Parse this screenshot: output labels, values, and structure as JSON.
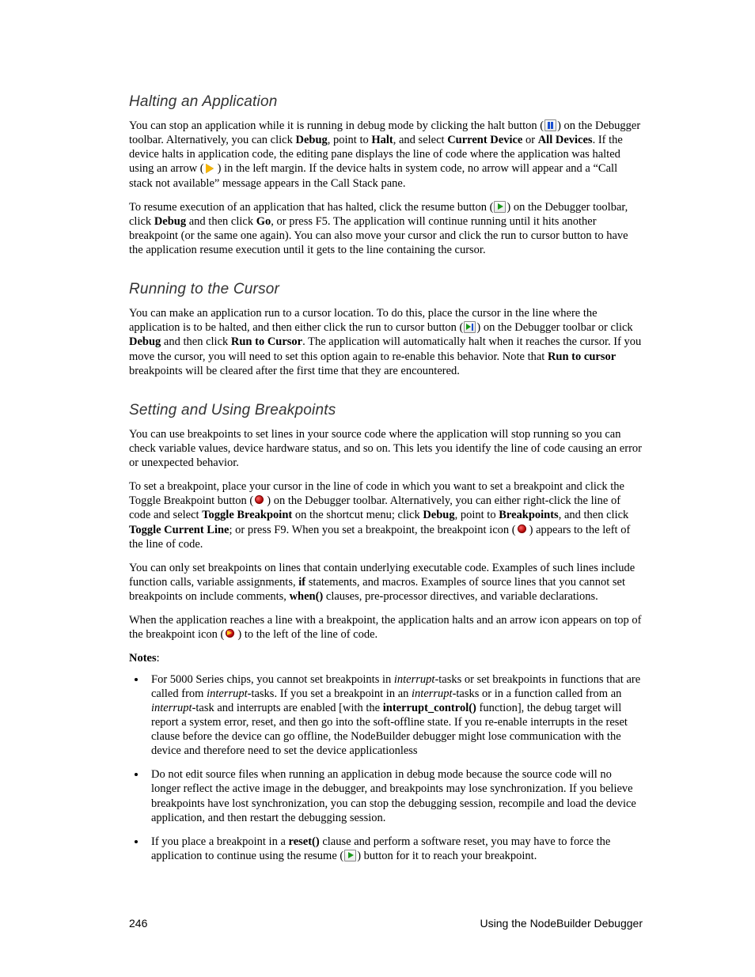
{
  "footer": {
    "page_number": "246",
    "title": "Using the NodeBuilder Debugger"
  },
  "sections": {
    "halting": {
      "heading": "Halting an Application",
      "p1": {
        "a": "You can stop an application while it is running in debug mode by clicking the halt button (",
        "b": ") on the Debugger toolbar.  Alternatively, you can click ",
        "bold_debug": "Debug",
        "c": ", point to ",
        "bold_halt": "Halt",
        "d": ", and select ",
        "bold_current": "Current Device",
        "e": " or ",
        "bold_all": "All Devices",
        "f": ".  If the device halts in application code, the editing pane displays the line of code where the application was halted using an arrow (",
        "g": ") in the left margin.  If the device halts in system code, no arrow will appear and a “Call stack not available” message appears in the Call Stack pane."
      },
      "p2": {
        "a": "To resume execution of an application that has halted, click the resume button (",
        "b": ") on the Debugger toolbar, click ",
        "bold_debug": "Debug",
        "c": " and then click ",
        "bold_go": "Go",
        "d": ", or press F5.  The application will continue running until it hits another breakpoint (or the same one again).  You can also move your cursor and click the run to cursor button to have the application resume execution until it gets to the line containing the cursor."
      }
    },
    "running": {
      "heading": "Running to the Cursor",
      "p1": {
        "a": "You can make an application run to a cursor location.  To do this, place the cursor in the line where the application is to be halted, and then either click the run to cursor button (",
        "b": ") on the Debugger toolbar or click ",
        "bold_debug": "Debug",
        "c": " and then click ",
        "bold_rtc": "Run to Cursor",
        "d": ".  The application will automatically halt when it reaches the cursor.  If you move the cursor, you will need to set this option again to re-enable this behavior.  Note that ",
        "bold_rtc2": "Run to cursor",
        "e": " breakpoints will be cleared after the first time that they are encountered."
      }
    },
    "breakpoints": {
      "heading": "Setting and Using Breakpoints",
      "p1": "You can use breakpoints to set lines in your source code where the application will stop running so you can check variable values, device hardware status, and so on.  This lets you identify the line of code causing an error or unexpected behavior.",
      "p2": {
        "a": "To set a breakpoint, place your cursor in the line of code in which you want to set a breakpoint and click the Toggle Breakpoint button (",
        "b": ") on the Debugger toolbar.  Alternatively, you can either right-click the line of code and select ",
        "bold_tb": "Toggle Breakpoint",
        "c": " on the shortcut menu; click ",
        "bold_debug": "Debug",
        "d": ", point to ",
        "bold_bp": "Breakpoints",
        "e": ", and then click ",
        "bold_tcl": "Toggle Current Line",
        "f": "; or press F9.  When you set a breakpoint, the breakpoint icon (",
        "g": ") appears to the left of the line of code."
      },
      "p3": {
        "a": "You can only set breakpoints on lines that contain underlying executable code.  Examples of such lines include function calls, variable assignments, ",
        "bold_if": "if",
        "b": " statements, and macros.  Examples of source lines that you cannot set breakpoints on include comments, ",
        "bold_when": "when()",
        "c": " clauses, pre-processor directives, and variable declarations."
      },
      "p4": {
        "a": "When the application reaches a line with a breakpoint, the application halts and an arrow icon appears on top of the breakpoint icon (",
        "b": ") to the left of the line of code."
      },
      "notes_label": "Notes",
      "notes": [
        {
          "a": "For 5000 Series chips, you cannot set breakpoints in ",
          "it_int": "interrupt",
          "b": "-tasks or set breakpoints in functions that are called from ",
          "it_int2": "interrupt",
          "c": "-tasks.  If you set a breakpoint in an ",
          "it_int3": "interrupt",
          "d": "-tasks or in a function called from an ",
          "it_int4": "interrupt",
          "e": "-task and interrupts are enabled [with the ",
          "bold_ic": "interrupt_control()",
          "f": " function], the debug target will report a system error, reset, and then go into the soft-offline state.  If you re-enable interrupts in the reset clause before the device can go offline, the NodeBuilder debugger might lose communication with the device and therefore need to set the device applicationless"
        },
        {
          "a": "Do not edit source files when running an application in debug mode because the source code will no longer reflect the active image in the debugger, and breakpoints may lose synchronization.  If you believe breakpoints have lost synchronization, you can stop the debugging session, recompile and load the device application, and then restart the debugging session."
        },
        {
          "a": "If you place a breakpoint in a ",
          "bold_reset": "reset()",
          "b": " clause and perform a software reset, you may have to force the application to continue using the resume (",
          "c": ") button for it to reach your breakpoint."
        }
      ]
    }
  }
}
